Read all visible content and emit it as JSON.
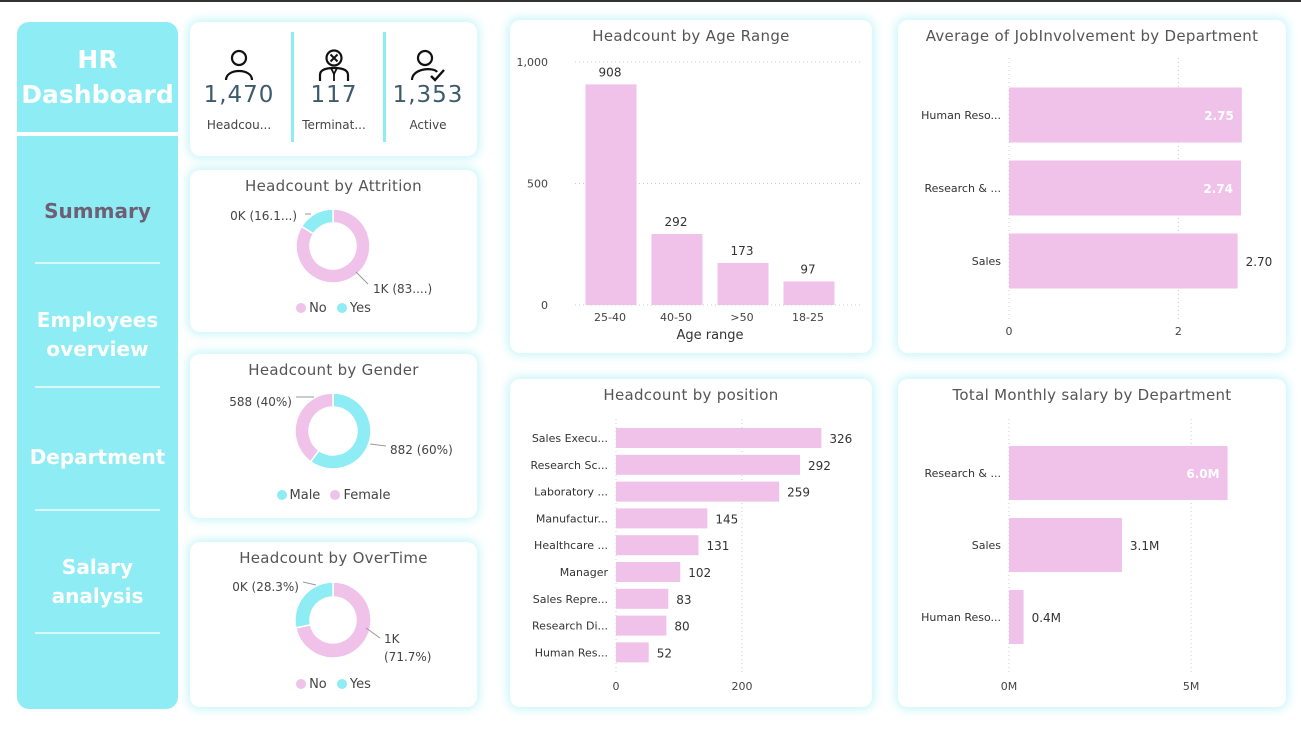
{
  "colors": {
    "accent": "#8eecf4",
    "bar": "#f0c2e9",
    "text": "#555555"
  },
  "sidebar": {
    "title_line1": "HR",
    "title_line2": "Dashboard",
    "items": [
      {
        "line1": "Summary",
        "line2": ""
      },
      {
        "line1": "Employees",
        "line2": "overview"
      },
      {
        "line1": "Department",
        "line2": ""
      },
      {
        "line1": "Salary",
        "line2": "analysis"
      }
    ]
  },
  "kpis": [
    {
      "icon": "person-icon",
      "value": "1,470",
      "label": "Headcou..."
    },
    {
      "icon": "terminated-person-icon",
      "value": "117",
      "label": "Terminat..."
    },
    {
      "icon": "active-person-icon",
      "value": "1,353",
      "label": "Active"
    }
  ],
  "chart_data": [
    {
      "id": "attrition",
      "type": "donut",
      "title": "Headcount by Attrition",
      "slices": [
        {
          "name": "No",
          "value": 83.9,
          "label": "1K (83....)",
          "color": "#f0c2e9"
        },
        {
          "name": "Yes",
          "value": 16.1,
          "label": "0K (16.1...)",
          "color": "#8eecf4"
        }
      ],
      "legend": [
        "No",
        "Yes"
      ]
    },
    {
      "id": "gender",
      "type": "donut",
      "title": "Headcount by Gender",
      "slices": [
        {
          "name": "Male",
          "value": 882,
          "label": "882 (60%)",
          "color": "#8eecf4"
        },
        {
          "name": "Female",
          "value": 588,
          "label": "588 (40%)",
          "color": "#f0c2e9"
        }
      ],
      "legend": [
        "Male",
        "Female"
      ]
    },
    {
      "id": "overtime",
      "type": "donut",
      "title": "Headcount by OverTime",
      "slices": [
        {
          "name": "No",
          "value": 71.7,
          "label": "1K (71.7%)",
          "color": "#f0c2e9"
        },
        {
          "name": "Yes",
          "value": 28.3,
          "label": "0K (28.3%)",
          "color": "#8eecf4"
        }
      ],
      "legend": [
        "No",
        "Yes"
      ]
    },
    {
      "id": "age",
      "type": "bar",
      "title": "Headcount by Age Range",
      "xlabel": "Age range",
      "categories": [
        "25-40",
        "40-50",
        ">50",
        "18-25"
      ],
      "values": [
        908,
        292,
        173,
        97
      ],
      "labels": [
        "908",
        "292",
        "173",
        "97"
      ],
      "ylim": [
        0,
        1000
      ],
      "yticks": [
        0,
        500,
        1000
      ],
      "ytick_labels": [
        "0",
        "500",
        "1,000"
      ]
    },
    {
      "id": "jobinv",
      "type": "bar",
      "orientation": "horizontal",
      "title": "Average of JobInvolvement by Department",
      "categories": [
        "Human Reso...",
        "Research & ...",
        "Sales"
      ],
      "values": [
        2.75,
        2.74,
        2.7
      ],
      "labels": [
        "2.75",
        "2.74",
        "2.70"
      ],
      "xlim": [
        0,
        3
      ],
      "xticks": [
        0,
        2
      ],
      "xtick_labels": [
        "0",
        "2"
      ]
    },
    {
      "id": "position",
      "type": "bar",
      "orientation": "horizontal",
      "title": "Headcount by position",
      "categories": [
        "Sales Execu...",
        "Research Sc...",
        "Laboratory ...",
        "Manufactur...",
        "Healthcare ...",
        "Manager",
        "Sales Repre...",
        "Research Di...",
        "Human Res..."
      ],
      "values": [
        326,
        292,
        259,
        145,
        131,
        102,
        83,
        80,
        52
      ],
      "labels": [
        "326",
        "292",
        "259",
        "145",
        "131",
        "102",
        "83",
        "80",
        "52"
      ],
      "xlim": [
        0,
        400
      ],
      "xticks": [
        0,
        200
      ],
      "xtick_labels": [
        "0",
        "200"
      ]
    },
    {
      "id": "salary",
      "type": "bar",
      "orientation": "horizontal",
      "title": "Total Monthly salary by Department",
      "categories": [
        "Research & ...",
        "Sales",
        "Human Reso..."
      ],
      "values": [
        6.0,
        3.1,
        0.4
      ],
      "labels": [
        "6.0M",
        "3.1M",
        "0.4M"
      ],
      "xlim": [
        0,
        7
      ],
      "xticks": [
        0,
        5
      ],
      "xtick_labels": [
        "0M",
        "5M"
      ]
    }
  ]
}
